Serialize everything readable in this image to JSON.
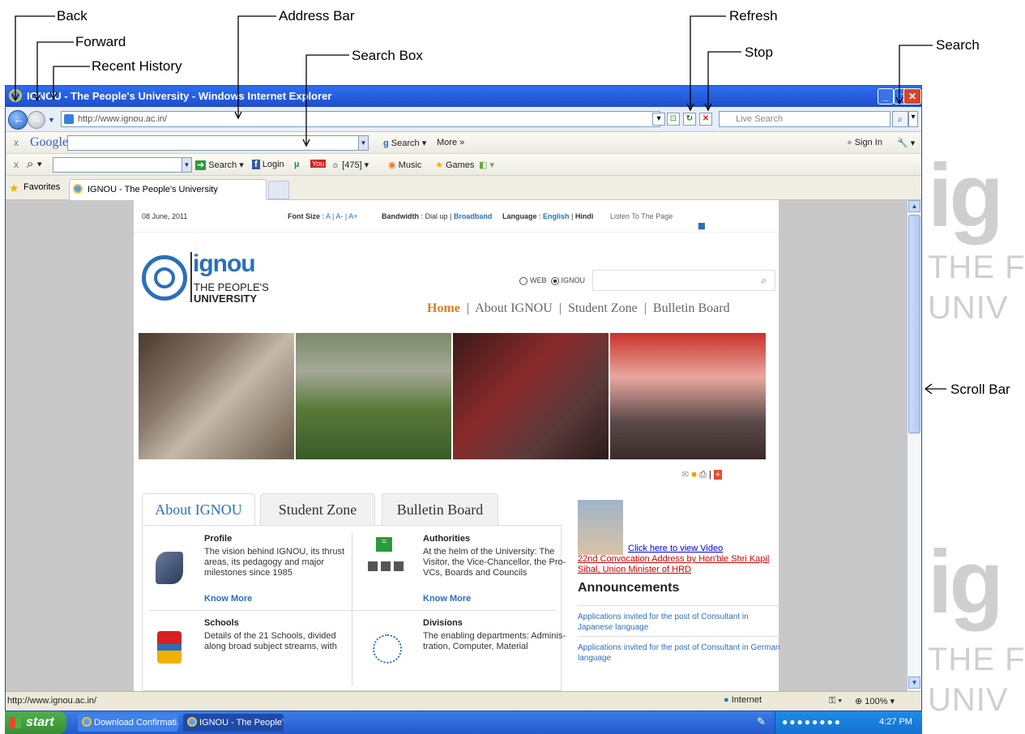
{
  "callouts": {
    "back": "Back",
    "forward": "Forward",
    "recent_history": "Recent History",
    "address_bar": "Address Bar",
    "search_box": "Search Box",
    "refresh": "Refresh",
    "stop": "Stop",
    "search": "Search",
    "scroll_bar": "Scroll Bar"
  },
  "watermark": {
    "logo1": "ig",
    "line1": "THE F",
    "line2": "UNIV",
    "logo2": "ig",
    "line3": "THE F",
    "line4": "UNIV"
  },
  "window": {
    "title": "IGNOU - The People's University - Windows Internet Explorer",
    "address": "http://www.ignou.ac.in/",
    "live_search_placeholder": "Live Search"
  },
  "google_toolbar": {
    "close": "x",
    "brand": "Google",
    "search_label": "Search",
    "more_label": "More »",
    "sign_in": "Sign In"
  },
  "second_toolbar": {
    "close": "x",
    "search_label": "Search",
    "login_label": "Login",
    "count_label": "[475]",
    "music_label": "Music",
    "games_label": "Games"
  },
  "tabs": {
    "favorites": "Favorites",
    "current_tab": "IGNOU - The People's University"
  },
  "site": {
    "date": "08 June, 2011",
    "font_size_label": "Font Size",
    "font_sizes": "A | A- | A+",
    "bandwidth_label": "Bandwidth",
    "bandwidth_dialup": "Dial up",
    "bandwidth_broadband": "Broadband",
    "language_label": "Language",
    "lang_english": "English",
    "lang_hindi": "Hindi",
    "listen": "Listen To The Page",
    "logo_word": "ignou",
    "logo_line1": "THE PEOPLE'S",
    "logo_line2": "UNIVERSITY",
    "search_web": "WEB",
    "search_ignou": "IGNOU",
    "menu": {
      "home": "Home",
      "about": "About IGNOU",
      "student": "Student Zone",
      "bulletin": "Bulletin Board"
    },
    "content_tabs": [
      "About IGNOU",
      "Student Zone",
      "Bulletin Board"
    ],
    "blocks": [
      {
        "title": "Profile",
        "text": "The vision behind IGNOU, its thrust areas, its pedagogy and major milestones since 1985",
        "link": "Know More"
      },
      {
        "title": "Authorities",
        "text": "At the helm of the University: The Visitor, the Vice-Chancellor, the Pro-VCs, Boards and Councils",
        "link": "Know More"
      },
      {
        "title": "Schools",
        "text": "Details of the 21 Schools, divided along broad subject streams, with",
        "link": ""
      },
      {
        "title": "Divisions",
        "text": "The enabling departments: Adminis-tration, Computer, Material",
        "link": ""
      }
    ],
    "video_link": "Click here to view Video",
    "convocation": "22nd Convocation Address by Hon'ble Shri Kapil Sibal, Union Minister of HRD",
    "announcements_title": "Announcements",
    "announcements": [
      "Applications invited for the post of Consultant in Japanese language",
      "Applications invited for the post of Consultant in German language"
    ]
  },
  "statusbar": {
    "url": "http://www.ignou.ac.in/",
    "zone": "Internet",
    "zoom": "100%"
  },
  "taskbar": {
    "start": "start",
    "task1": "Download Confirmati...",
    "task2": "IGNOU - The People's...",
    "time": "4:27 PM"
  }
}
